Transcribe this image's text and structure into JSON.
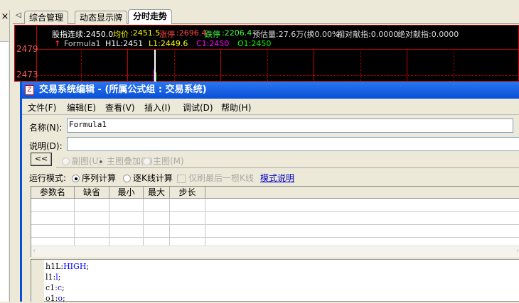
{
  "left_panel": {
    "close": "×"
  },
  "tabs": {
    "scroll": "◁",
    "items": [
      "综合管理",
      "动态显示牌",
      "分时走势"
    ],
    "active": 2
  },
  "chart_header": {
    "index": "股指连续:2450.0",
    "avg_label": "均价",
    "avg": ":2451.5",
    "up_label": "涨停",
    "up": ":2696.4",
    "down_label": "跌停",
    "down": ":2206.4",
    "vol": "预估量:27.6万(换0.00%)",
    "rel": "相对献指:0.0000",
    "abs": "绝对献指:0.0000",
    "arrow": "↑",
    "formula": "Formula1",
    "h1l": "H1L:2451",
    "l1": "L1:2449.6",
    "c1": "C1:2450",
    "o1": "O1:2450"
  },
  "chart_axis": {
    "y1": "2479",
    "y2": "2473"
  },
  "dialog": {
    "icon": "Z",
    "title": "交易系统编辑 - (所属公式组 : 交易系统)",
    "menu": [
      "文件(F)",
      "编辑(E)",
      "查看(V)",
      "插入(I)",
      "调试(D)",
      "帮助(H)"
    ],
    "name_label": "名称(N):",
    "name_value": "Formula1",
    "desc_label": "说明(D):",
    "desc_value": "",
    "collapse_btn": "<<",
    "chart_types": [
      "副图(U)",
      "主图叠加(T)",
      "主图(M)"
    ],
    "run_mode_label": "运行模式:",
    "run_modes": [
      "序列计算",
      "逐K线计算"
    ],
    "only_last": "仅刷最后一根K线",
    "mode_help": "模式说明",
    "param_headers": [
      "参数名",
      "缺省",
      "最小",
      "最大",
      "步长"
    ],
    "code": [
      {
        "name": "h1L:",
        "val": "HIGH",
        "end": ";"
      },
      {
        "name": "l1:",
        "val": "l",
        "end": ";"
      },
      {
        "name": "c1:",
        "val": "c",
        "end": ";"
      },
      {
        "name": "o1:",
        "val": "o",
        "end": ";"
      }
    ]
  }
}
